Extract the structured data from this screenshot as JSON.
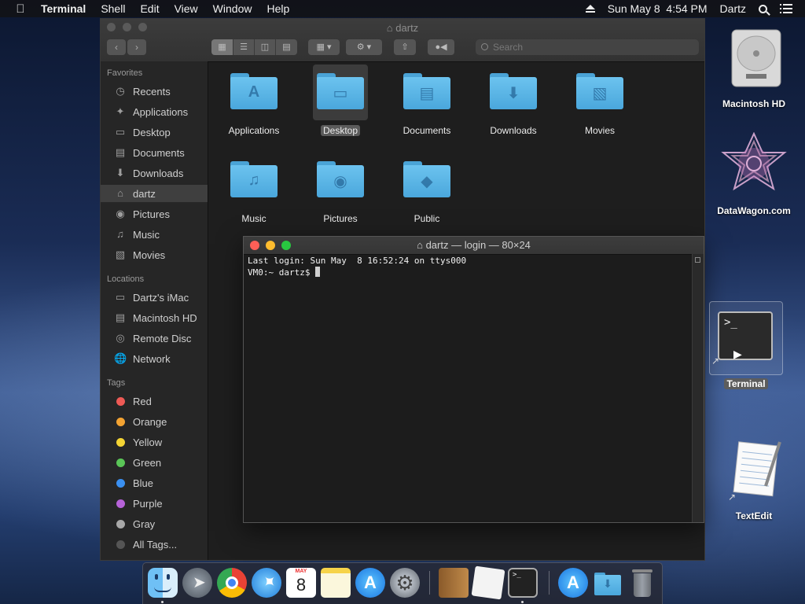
{
  "menubar": {
    "apple": "",
    "items": [
      "Terminal",
      "Shell",
      "Edit",
      "View",
      "Window",
      "Help"
    ],
    "datetime": "Sun May 8  4:54 PM",
    "user": "Dartz"
  },
  "finder": {
    "title": "dartz",
    "search_placeholder": "Search",
    "sidebar": {
      "favorites_header": "Favorites",
      "favorites": [
        "Recents",
        "Applications",
        "Desktop",
        "Documents",
        "Downloads",
        "dartz",
        "Pictures",
        "Music",
        "Movies"
      ],
      "locations_header": "Locations",
      "locations": [
        "Dartz's iMac",
        "Macintosh HD",
        "Remote Disc",
        "Network"
      ],
      "tags_header": "Tags",
      "tags": [
        {
          "label": "Red",
          "color": "#ee5a55"
        },
        {
          "label": "Orange",
          "color": "#f3a332"
        },
        {
          "label": "Yellow",
          "color": "#f4d434"
        },
        {
          "label": "Green",
          "color": "#5ac557"
        },
        {
          "label": "Blue",
          "color": "#3a8ff0"
        },
        {
          "label": "Purple",
          "color": "#b662d8"
        },
        {
          "label": "Gray",
          "color": "#a8a8a8"
        }
      ],
      "all_tags": "All Tags..."
    },
    "folders": [
      "Applications",
      "Desktop",
      "Documents",
      "Downloads",
      "Movies",
      "Music",
      "Pictures",
      "Public"
    ]
  },
  "terminal": {
    "title": "dartz — login — 80×24",
    "line1": "Last login: Sun May  8 16:52:24 on ttys000",
    "prompt": "VM0:~ dartz$ "
  },
  "desktop": {
    "macintosh_hd": "Macintosh HD",
    "datawagon": "DataWagon.com",
    "terminal": "Terminal",
    "terminal_glyph": ">_",
    "textedit": "TextEdit"
  },
  "dock": {
    "calendar_month": "MAY",
    "calendar_day": "8"
  },
  "colors": {
    "close": "#fe5f57",
    "minimize": "#febc2e",
    "zoom": "#28c840",
    "folder": "#5bb6e8"
  }
}
